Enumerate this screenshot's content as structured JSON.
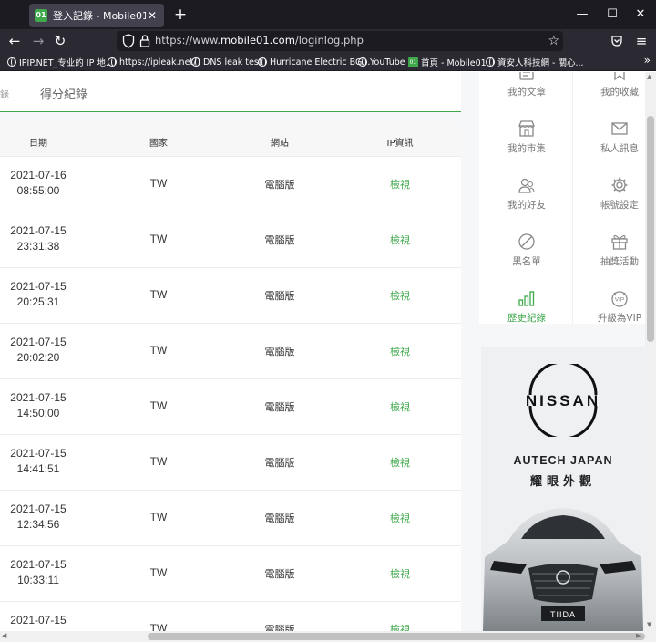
{
  "browser": {
    "tab_title": "登入記錄 - Mobile01",
    "tab_favicon_text": "01",
    "url_prefix": "https://www.",
    "url_domain": "mobile01.com",
    "url_path": "/loginlog.php",
    "bookmarks": [
      {
        "label": "IPIP.NET_专业的 IP 地...",
        "icon": "globe-icon"
      },
      {
        "label": "https://ipleak.net/",
        "icon": "globe-icon"
      },
      {
        "label": "DNS leak test",
        "icon": "globe-icon"
      },
      {
        "label": "Hurricane Electric BG...",
        "icon": "globe-icon"
      },
      {
        "label": "YouTube",
        "icon": "globe-icon"
      },
      {
        "label": "首頁 - Mobile01",
        "icon": "mobile01-icon"
      },
      {
        "label": "資安人科技網 - 關心...",
        "icon": "globe-icon"
      }
    ]
  },
  "page": {
    "left_edge_char": "錄",
    "score_tab": "得分紀錄",
    "table": {
      "headers": [
        "日期",
        "國家",
        "網站",
        "IP資訊"
      ],
      "rows": [
        {
          "date": "2021-07-16",
          "time": "08:55:00",
          "country": "TW",
          "site": "電腦版",
          "ip": "檢視"
        },
        {
          "date": "2021-07-15",
          "time": "23:31:38",
          "country": "TW",
          "site": "電腦版",
          "ip": "檢視"
        },
        {
          "date": "2021-07-15",
          "time": "20:25:31",
          "country": "TW",
          "site": "電腦版",
          "ip": "檢視"
        },
        {
          "date": "2021-07-15",
          "time": "20:02:20",
          "country": "TW",
          "site": "電腦版",
          "ip": "檢視"
        },
        {
          "date": "2021-07-15",
          "time": "14:50:00",
          "country": "TW",
          "site": "電腦版",
          "ip": "檢視"
        },
        {
          "date": "2021-07-15",
          "time": "14:41:51",
          "country": "TW",
          "site": "電腦版",
          "ip": "檢視"
        },
        {
          "date": "2021-07-15",
          "time": "12:34:56",
          "country": "TW",
          "site": "電腦版",
          "ip": "檢視"
        },
        {
          "date": "2021-07-15",
          "time": "10:33:11",
          "country": "TW",
          "site": "電腦版",
          "ip": "檢視"
        },
        {
          "date": "2021-07-15",
          "time": "",
          "country": "TW",
          "site": "電腦版",
          "ip": "檢視"
        }
      ]
    }
  },
  "sidebar": {
    "menu": [
      {
        "label": "我的文章",
        "icon": "article-icon"
      },
      {
        "label": "我的收藏",
        "icon": "bookmark-icon"
      },
      {
        "label": "我的市集",
        "icon": "store-icon"
      },
      {
        "label": "私人訊息",
        "icon": "mail-icon"
      },
      {
        "label": "我的好友",
        "icon": "friends-icon"
      },
      {
        "label": "帳號設定",
        "icon": "gear-icon"
      },
      {
        "label": "黑名單",
        "icon": "block-icon"
      },
      {
        "label": "抽獎活動",
        "icon": "gift-icon"
      },
      {
        "label": "歷史紀錄",
        "icon": "bar-chart-icon",
        "active": true
      },
      {
        "label": "升級為VIP",
        "icon": "vip-icon"
      }
    ],
    "ad": {
      "brand": "NISSAN",
      "headline": "AUTECH JAPAN",
      "slogan": "耀眼外觀",
      "plate": "TIIDA"
    }
  },
  "colors": {
    "accent": "#3ea84b",
    "browser_dark": "#1c1b22",
    "browser_toolbar": "#2b2a33"
  }
}
